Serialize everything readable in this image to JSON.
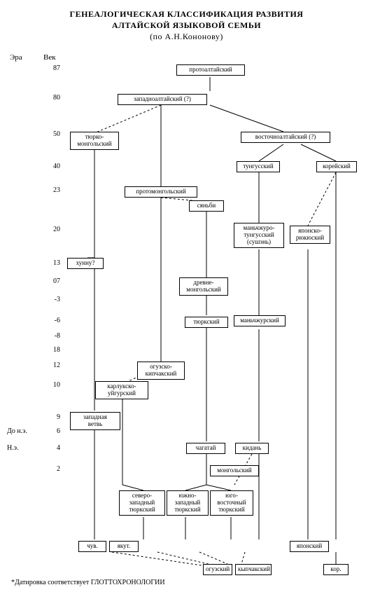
{
  "title": {
    "line1": "ГЕНЕАЛОГИЧЕСКАЯ КЛАССИФИКАЦИЯ РАЗВИТИЯ",
    "line2": "АЛТАЙСКОЙ ЯЗЫКОВОЙ СЕМЬИ",
    "line3": "(по А.Н.Кононову)"
  },
  "columns": {
    "era": "Эра",
    "century": "Век"
  },
  "dates": {
    "d87": "87",
    "d80": "80",
    "d50": "50",
    "d40": "40",
    "d23": "23",
    "d20": "20",
    "d13": "13",
    "d07": "07",
    "dN3": "-3",
    "dN6": "-6",
    "dN8": "-8",
    "d18a": "18",
    "d12": "12",
    "d10": "10",
    "d9": "9",
    "d6": "6",
    "d4": "4",
    "d2": "2"
  },
  "eras": {
    "bce": "До н.э.",
    "ce": "Н.э."
  },
  "nodes": {
    "protoAltaic": "протоалтайский",
    "westernAltaic": "западноалтайский (?)",
    "turkomongol": "тюрко-\nмонгольский",
    "easternAltaic": "восточноалтайский (?)",
    "tungusic": "тунгусский",
    "korean": "корейский",
    "protoMongol": "протомонгольский",
    "xianbei": "сяньби",
    "manchu": "маньчжуро-\nтунгусский\n(сушэнь)",
    "japRyukyu": "японско-\nрюкюский",
    "xiongnu": "хунну?",
    "ancMongol": "древне-\nмонгольский",
    "oldTurkic": "тюркский",
    "oghuzKipchak": "огузско-кипчакский",
    "karluk": "карлукско-\nуйгурский",
    "westBr": "западная\nветвь",
    "chagatai": "чагатай",
    "khitan": "кидань",
    "modMongol": "монгольский",
    "modManchu": "маньчжурский",
    "nwTurkic": "северо-\nзападный\nтюркский",
    "swTurkic": "южно-\nзападный\nтюркский",
    "seTurkic": "юго-\nвосточный\nтюркский",
    "oghuz": "огузский",
    "kipchak": "кыпчакский",
    "modChuv": "чув.",
    "modYakut": "якут.",
    "modJap": "японский",
    "modKor": "кор."
  },
  "footnote": "*Датировка соответствует ГЛОТТОХРОНОЛОГИИ"
}
